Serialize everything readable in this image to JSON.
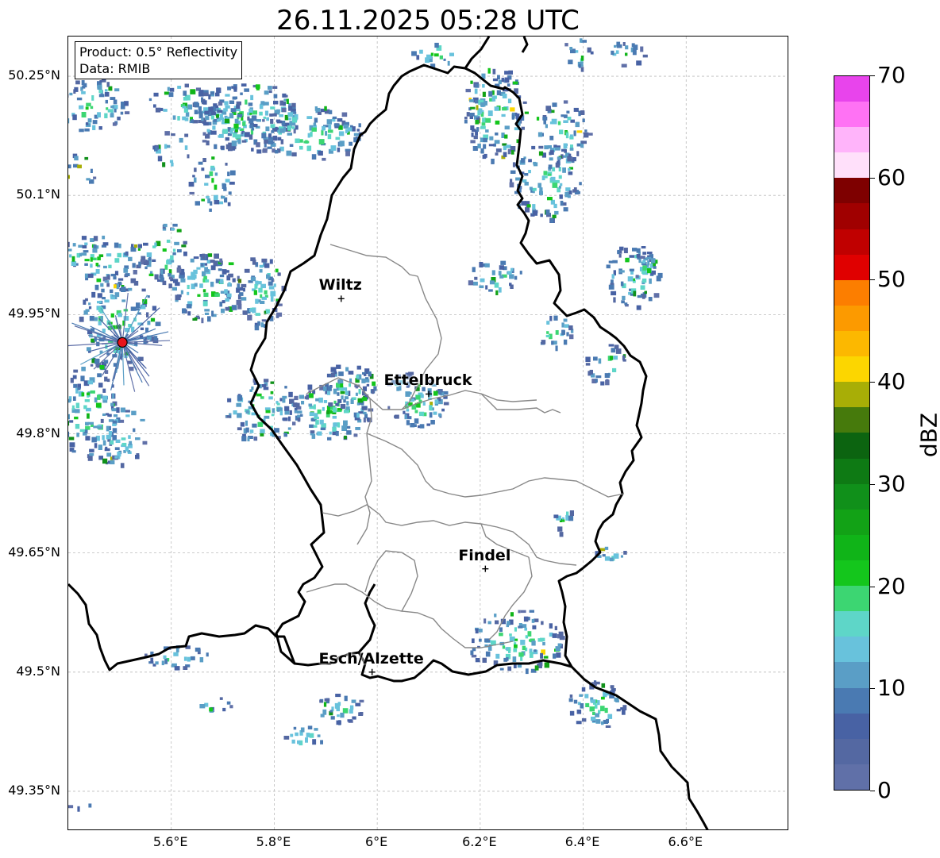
{
  "title": "26.11.2025 05:28 UTC",
  "info": {
    "product": "Product: 0.5° Reflectivity",
    "source": "Data: RMIB"
  },
  "lat_ticks": [
    "50.25°N",
    "50.1°N",
    "49.95°N",
    "49.8°N",
    "49.65°N",
    "49.5°N",
    "49.35°N"
  ],
  "lon_ticks": [
    "5.6°E",
    "5.8°E",
    "6°E",
    "6.2°E",
    "6.4°E",
    "6.6°E"
  ],
  "cities": [
    {
      "name": "Wiltz",
      "lon": 5.93,
      "lat": 49.97
    },
    {
      "name": "Ettelbruck",
      "lon": 6.1,
      "lat": 49.85
    },
    {
      "name": "Findel",
      "lon": 6.21,
      "lat": 49.63
    },
    {
      "name": "Esch/Alzette",
      "lon": 5.99,
      "lat": 49.5
    }
  ],
  "radar_site": {
    "lon": 5.505,
    "lat": 49.915,
    "color": "#e8141c"
  },
  "map_extent": {
    "lon_min": 5.4,
    "lon_max": 6.8,
    "lat_min": 49.3,
    "lat_max": 50.3
  },
  "colorbar": {
    "unit": "dBZ",
    "min": 0,
    "max": 70,
    "tick_labels": [
      "0",
      "10",
      "20",
      "30",
      "40",
      "50",
      "60",
      "70"
    ],
    "colors": [
      "#6070a8",
      "#5468a2",
      "#4862a4",
      "#4a7ab2",
      "#5a9ec6",
      "#68c2dc",
      "#5ed6c8",
      "#3cd672",
      "#14c61c",
      "#10b418",
      "#12a216",
      "#10901a",
      "#0e7a14",
      "#0c6410",
      "#467a0c",
      "#a8ae06",
      "#fcd600",
      "#fcb800",
      "#fc9a00",
      "#fc7e00",
      "#e00000",
      "#c00000",
      "#a00000",
      "#7e0000",
      "#ffe0fa",
      "#ffb4fa",
      "#ff72f4",
      "#e844ec"
    ]
  },
  "chart_data": {
    "type": "map",
    "title": "26.11.2025 05:28 UTC",
    "xlabel": "",
    "ylabel": "",
    "x_ticks": [
      "5.6°E",
      "5.8°E",
      "6°E",
      "6.2°E",
      "6.4°E",
      "6.6°E"
    ],
    "y_ticks": [
      "50.25°N",
      "50.1°N",
      "49.95°N",
      "49.8°N",
      "49.65°N",
      "49.5°N",
      "49.35°N"
    ],
    "xlim": [
      5.4,
      6.8
    ],
    "ylim": [
      49.3,
      50.3
    ],
    "grid": true,
    "colorbar_range": [
      0,
      70
    ],
    "colorbar_unit": "dBZ",
    "labels": [
      "Wiltz",
      "Ettelbruck",
      "Findel",
      "Esch/Alzette"
    ]
  }
}
